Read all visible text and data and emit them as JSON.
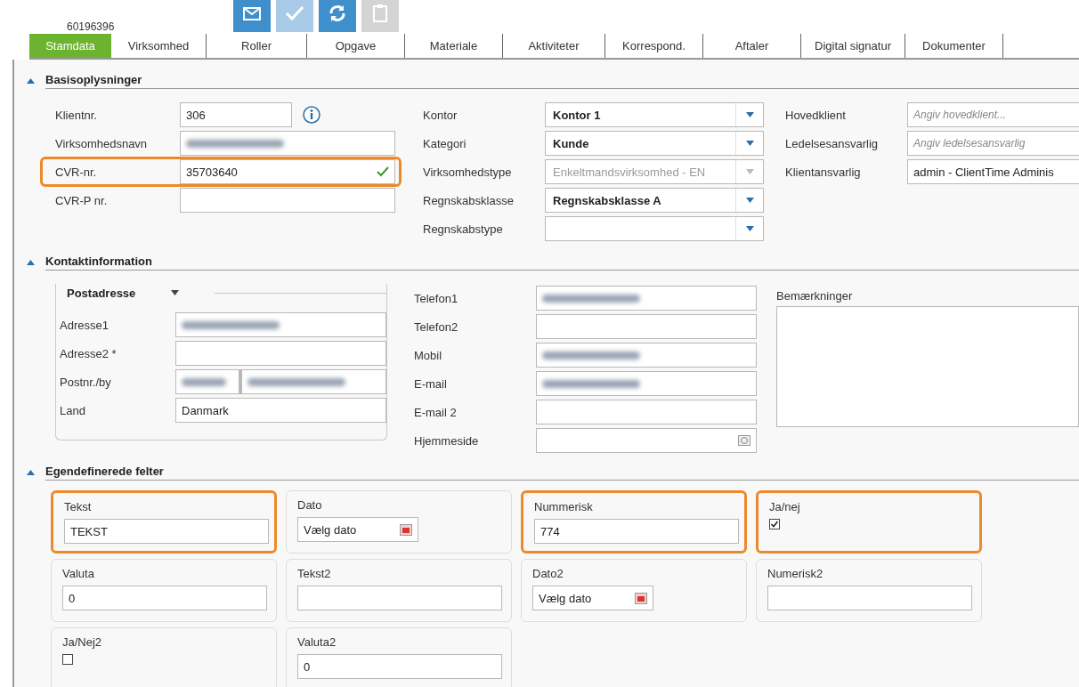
{
  "header": {
    "client_number": "60196396",
    "toolbar": [
      {
        "kind": "mail",
        "disabled": false
      },
      {
        "kind": "check",
        "disabled": false
      },
      {
        "kind": "sync",
        "disabled": false
      },
      {
        "kind": "clipboard",
        "disabled": true
      }
    ]
  },
  "tabs": [
    {
      "label": "Stamdata",
      "selected": true
    },
    {
      "label": "Virksomhed",
      "selected": false
    },
    {
      "label": "Roller",
      "selected": false
    },
    {
      "label": "Opgave",
      "selected": false
    },
    {
      "label": "Materiale",
      "selected": false
    },
    {
      "label": "Aktiviteter",
      "selected": false
    },
    {
      "label": "Korrespond.",
      "selected": false
    },
    {
      "label": "Aftaler",
      "selected": false
    },
    {
      "label": "Digital signatur",
      "selected": false
    },
    {
      "label": "Dokumenter",
      "selected": false
    }
  ],
  "basis": {
    "title": "Basisoplysninger",
    "expanded": true,
    "columns": [
      [
        {
          "label": "Klientnr.",
          "kind": "short",
          "value": "306",
          "info": true
        },
        {
          "label": "Virksomhedsnavn",
          "kind": "text",
          "redacted": true
        },
        {
          "label": "CVR-nr.",
          "kind": "text",
          "value": "35703640",
          "valid": true,
          "highlighted": true
        },
        {
          "label": "CVR-P nr.",
          "kind": "text"
        }
      ],
      [
        {
          "label": "Kontor",
          "kind": "dropdown",
          "value": "Kontor 1",
          "disabled": false
        },
        {
          "label": "Kategori",
          "kind": "dropdown",
          "value": "Kunde",
          "disabled": false
        },
        {
          "label": "Virksomhedstype",
          "kind": "dropdown",
          "value": "Enkeltmandsvirksomhed - EN",
          "disabled": true
        },
        {
          "label": "Regnskabsklasse",
          "kind": "dropdown",
          "value": "Regnskabsklasse A",
          "disabled": false
        },
        {
          "label": "Regnskabstype",
          "kind": "dropdown",
          "disabled": false
        }
      ],
      [
        {
          "label": "Hovedklient",
          "kind": "text",
          "placeholder": "Angiv hovedklient..."
        },
        {
          "label": "Ledelsesansvarlig",
          "kind": "text",
          "placeholder": "Angiv ledelsesansvarlig"
        },
        {
          "label": "Klientansvarlig",
          "kind": "text",
          "value": "admin - ClientTime Adminis"
        }
      ]
    ]
  },
  "kontakt": {
    "title": "Kontaktinformation",
    "expanded": true,
    "address_group": {
      "title": "Postadresse",
      "rows": [
        {
          "label": "Adresse1",
          "kind": "text",
          "redacted": true
        },
        {
          "label": "Adresse2 *",
          "kind": "text"
        },
        {
          "label": "Postnr./by",
          "kind": "split",
          "redacted": true
        },
        {
          "label": "Land",
          "kind": "text",
          "value": "Danmark"
        }
      ]
    },
    "rows": [
      {
        "label": "Telefon1",
        "kind": "text",
        "redacted": true
      },
      {
        "label": "Telefon2",
        "kind": "text"
      },
      {
        "label": "Mobil",
        "kind": "text",
        "redacted": true
      },
      {
        "label": "E-mail",
        "kind": "text",
        "redacted": true
      },
      {
        "label": "E-mail 2",
        "kind": "text"
      },
      {
        "label": "Hjemmeside",
        "kind": "link"
      }
    ],
    "notes_label": "Bemærkninger"
  },
  "custom": {
    "title": "Egendefinerede felter",
    "expanded": true,
    "fields": [
      {
        "label": "Tekst",
        "kind": "text",
        "value": "TEKST",
        "highlighted": true
      },
      {
        "label": "Dato",
        "kind": "date",
        "value": "Vælg dato",
        "highlighted": false
      },
      {
        "label": "Nummerisk",
        "kind": "text",
        "value": "774",
        "highlighted": true
      },
      {
        "label": "Ja/nej",
        "kind": "check",
        "checked": true,
        "highlighted": true
      },
      {
        "label": "Valuta",
        "kind": "text",
        "value": "0",
        "highlighted": false
      },
      {
        "label": "Tekst2",
        "kind": "text",
        "highlighted": false
      },
      {
        "label": "Dato2",
        "kind": "date",
        "value": "Vælg dato",
        "highlighted": false
      },
      {
        "label": "Numerisk2",
        "kind": "text",
        "highlighted": false
      },
      {
        "label": "Ja/Nej2",
        "kind": "check",
        "checked": false,
        "highlighted": false
      },
      {
        "label": "Valuta2",
        "kind": "text",
        "value": "0",
        "highlighted": false
      }
    ]
  }
}
